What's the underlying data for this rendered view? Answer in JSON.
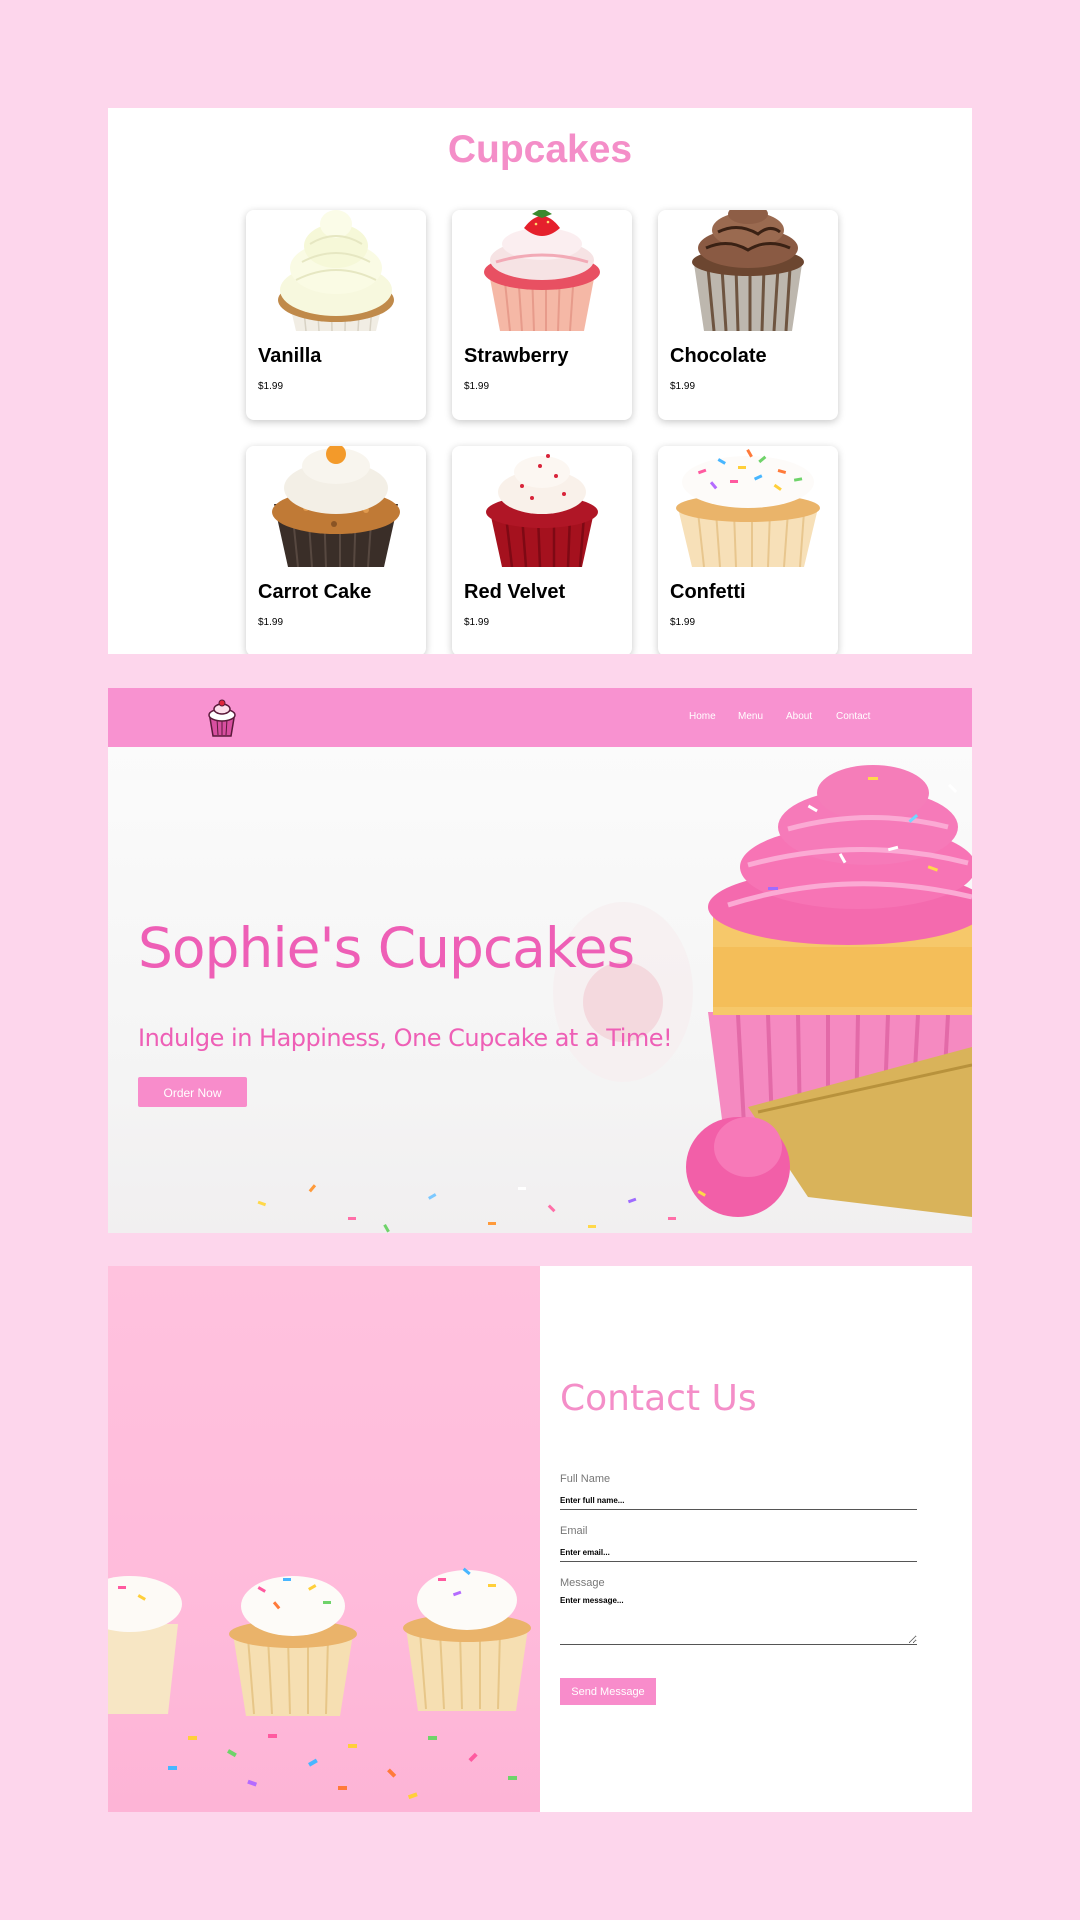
{
  "menu": {
    "title": "Cupcakes",
    "items": [
      {
        "name": "Vanilla",
        "price": "$1.99",
        "image": "vanilla-cupcake"
      },
      {
        "name": "Strawberry",
        "price": "$1.99",
        "image": "strawberry-cupcake"
      },
      {
        "name": "Chocolate",
        "price": "$1.99",
        "image": "chocolate-cupcake"
      },
      {
        "name": "Carrot Cake",
        "price": "$1.99",
        "image": "carrot-cupcake"
      },
      {
        "name": "Red Velvet",
        "price": "$1.99",
        "image": "red-velvet-cupcake"
      },
      {
        "name": "Confetti",
        "price": "$1.99",
        "image": "confetti-cupcake"
      }
    ]
  },
  "nav": {
    "logo": "cupcake-logo-icon",
    "links": [
      "Home",
      "Menu",
      "About",
      "Contact"
    ]
  },
  "hero": {
    "title": "Sophie's Cupcakes",
    "subtitle": "Indulge in Happiness, One Cupcake at a Time!",
    "button": "Order Now"
  },
  "contact": {
    "title": "Contact Us",
    "fields": {
      "name": {
        "label": "Full Name",
        "placeholder": "Enter full name..."
      },
      "email": {
        "label": "Email",
        "placeholder": "Enter email..."
      },
      "message": {
        "label": "Message",
        "placeholder": "Enter message..."
      }
    },
    "button": "Send Message"
  },
  "colors": {
    "page_bg": "#fdd6ec",
    "accent": "#f892d0",
    "title_pink": "#f48ec8",
    "hero_text": "#ee5fb6"
  }
}
